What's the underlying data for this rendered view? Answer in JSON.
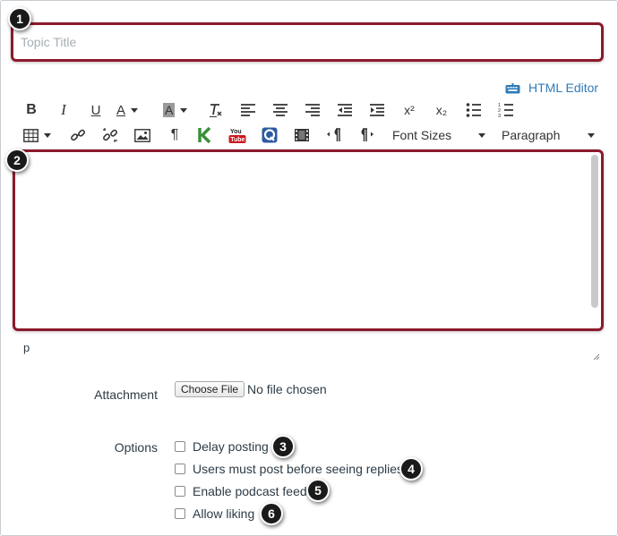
{
  "topic_title": {
    "placeholder": "Topic Title"
  },
  "html_editor": {
    "label": "HTML Editor",
    "icon": "keyboard-icon"
  },
  "toolbar": {
    "row1": [
      {
        "name": "bold-button",
        "glyph": "B"
      },
      {
        "name": "italic-button",
        "glyph": "I"
      },
      {
        "name": "underline-button",
        "glyph": "U"
      },
      {
        "name": "text-color-button",
        "glyph": "A"
      },
      {
        "name": "background-color-button",
        "glyph": "A"
      },
      {
        "name": "clear-formatting-button",
        "glyph": "T"
      },
      {
        "name": "align-left-button"
      },
      {
        "name": "align-center-button"
      },
      {
        "name": "align-right-button"
      },
      {
        "name": "outdent-button"
      },
      {
        "name": "indent-button"
      },
      {
        "name": "superscript-button",
        "glyph": "x²"
      },
      {
        "name": "subscript-button",
        "glyph": "x₂"
      },
      {
        "name": "bullet-list-button"
      },
      {
        "name": "numbered-list-button"
      }
    ],
    "font_sizes_label": "Font Sizes",
    "paragraph_label": "Paragraph",
    "youtube_label": "You Tube"
  },
  "editor": {
    "path": "p"
  },
  "attachment": {
    "label": "Attachment",
    "button_label": "Choose File",
    "status": "No file chosen"
  },
  "options": {
    "label": "Options",
    "items": [
      {
        "label": "Delay posting",
        "checked": false
      },
      {
        "label": "Users must post before seeing replies",
        "checked": false
      },
      {
        "label": "Enable podcast feed",
        "checked": false
      },
      {
        "label": "Allow liking",
        "checked": false
      }
    ]
  },
  "callouts": [
    "1",
    "2",
    "3",
    "4",
    "5",
    "6"
  ],
  "colors": {
    "highlight_border": "#8b1a2b",
    "link": "#2f7bb8",
    "badge": "#1a1a1a"
  }
}
